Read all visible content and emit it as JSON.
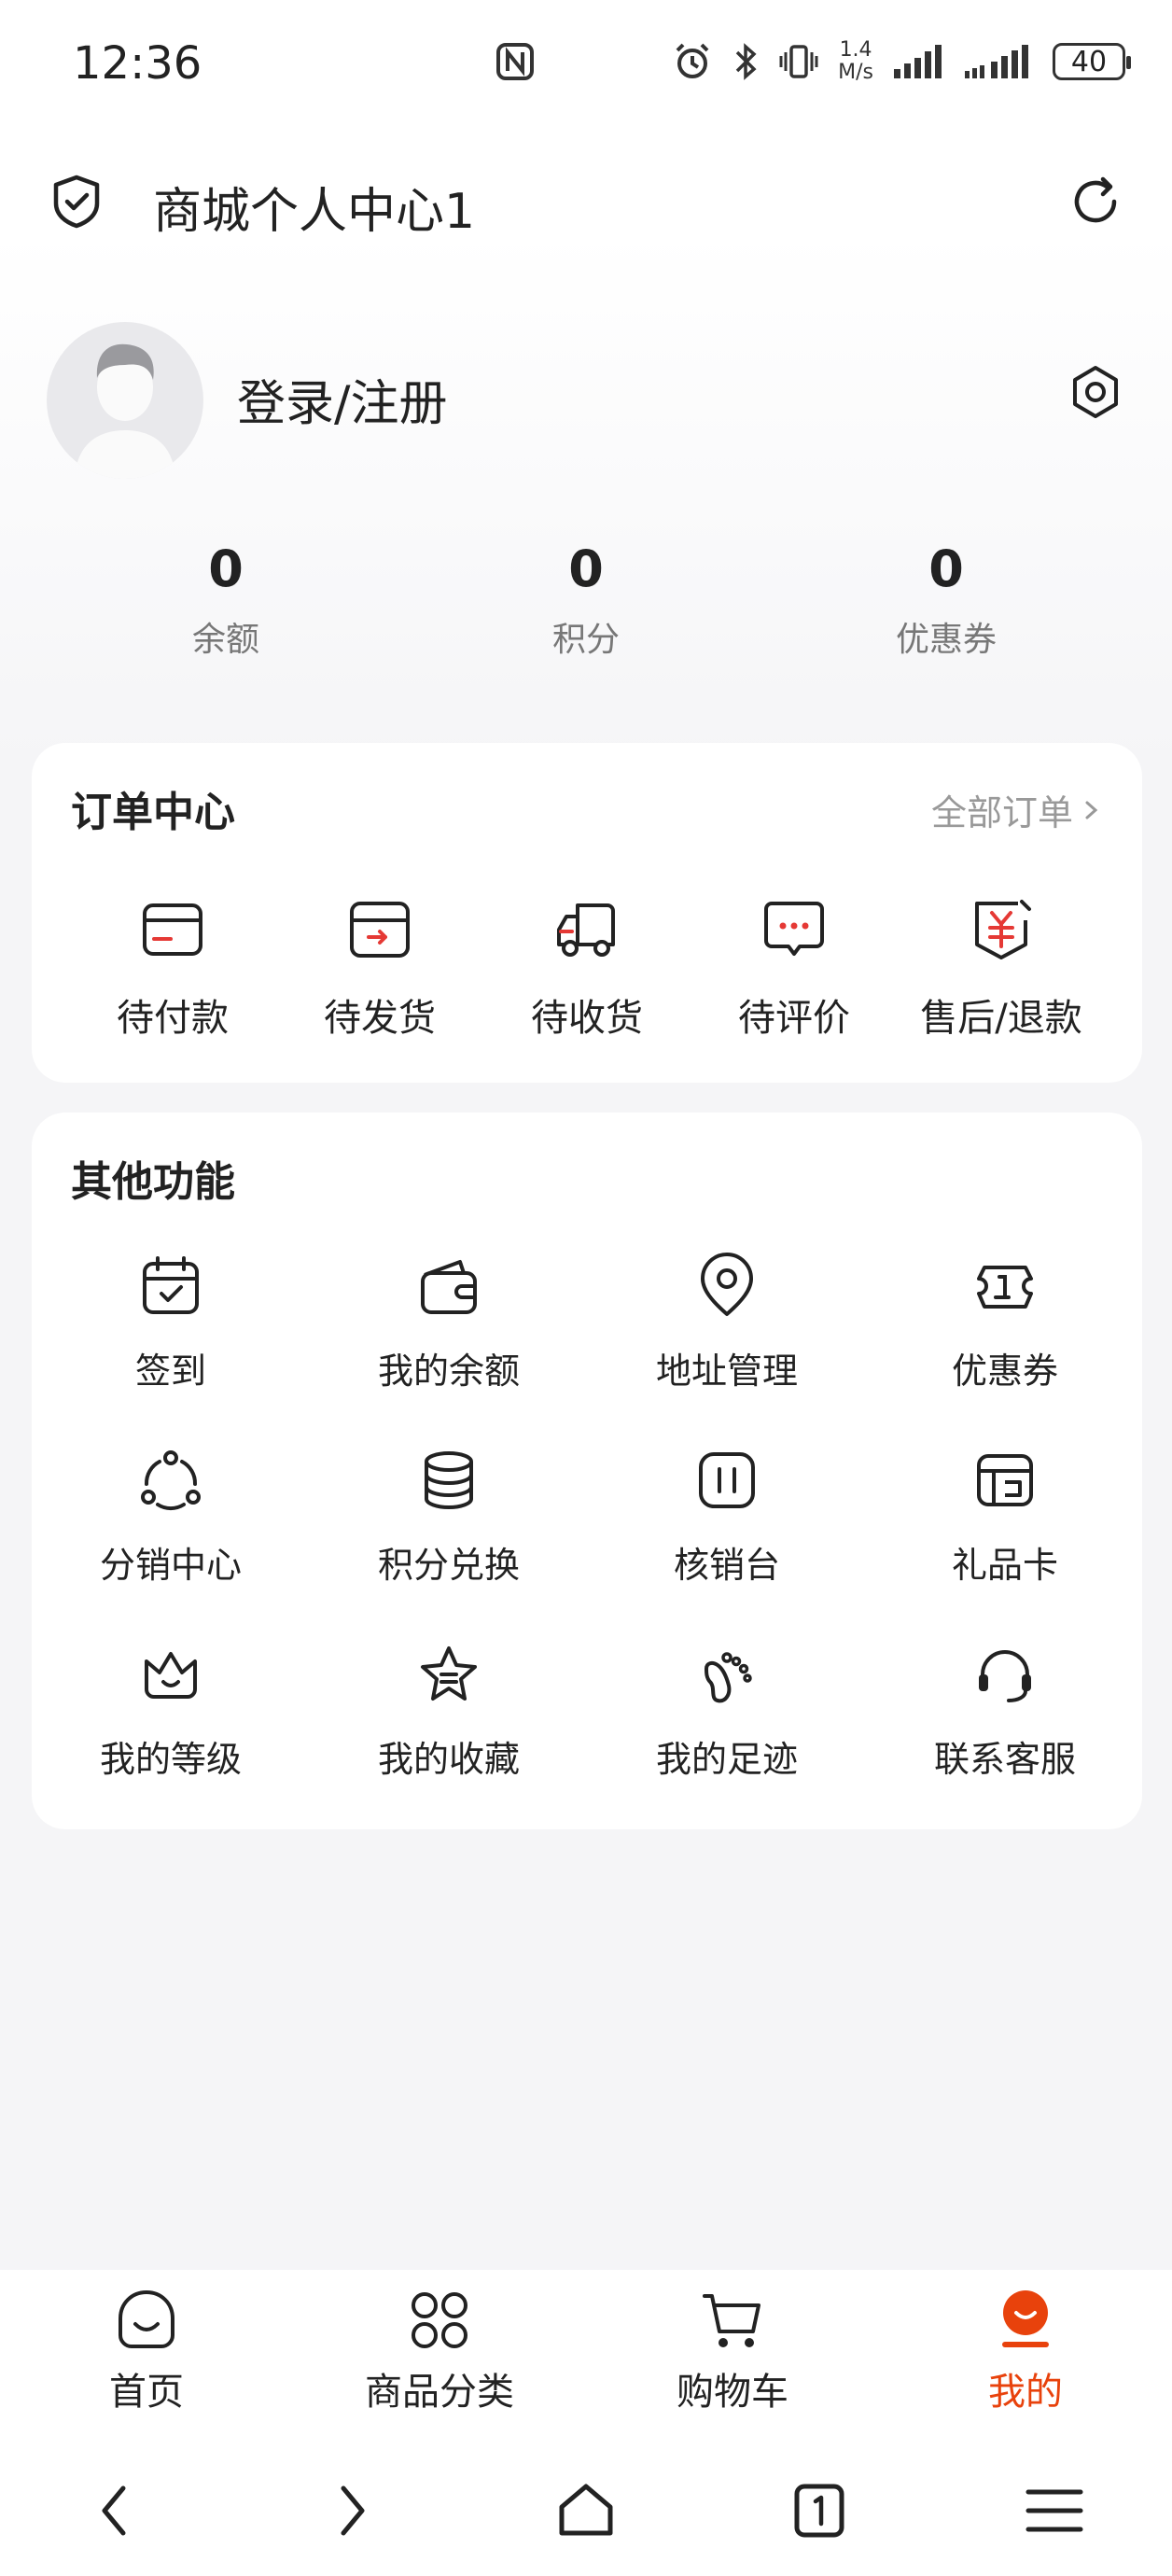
{
  "status_bar": {
    "time": "12:36",
    "net_speed_value": "1.4",
    "net_speed_unit": "M/s",
    "battery": "40"
  },
  "header": {
    "title": "商城个人中心1"
  },
  "profile": {
    "login_label": "登录/注册"
  },
  "stats": [
    {
      "value": "0",
      "label": "余额"
    },
    {
      "value": "0",
      "label": "积分"
    },
    {
      "value": "0",
      "label": "优惠券"
    }
  ],
  "orders": {
    "title": "订单中心",
    "all_label": "全部订单",
    "items": [
      {
        "label": "待付款",
        "icon": "card-icon"
      },
      {
        "label": "待发货",
        "icon": "box-icon"
      },
      {
        "label": "待收货",
        "icon": "truck-icon"
      },
      {
        "label": "待评价",
        "icon": "comment-icon"
      },
      {
        "label": "售后/退款",
        "icon": "refund-icon"
      }
    ]
  },
  "functions": {
    "title": "其他功能",
    "items": [
      {
        "label": "签到",
        "icon": "calendar-check-icon"
      },
      {
        "label": "我的余额",
        "icon": "wallet-icon"
      },
      {
        "label": "地址管理",
        "icon": "location-icon"
      },
      {
        "label": "优惠券",
        "icon": "ticket-icon"
      },
      {
        "label": "分销中心",
        "icon": "share-nodes-icon"
      },
      {
        "label": "积分兑换",
        "icon": "database-icon"
      },
      {
        "label": "核销台",
        "icon": "verify-icon"
      },
      {
        "label": "礼品卡",
        "icon": "gift-card-icon"
      },
      {
        "label": "我的等级",
        "icon": "crown-icon"
      },
      {
        "label": "我的收藏",
        "icon": "star-icon"
      },
      {
        "label": "我的足迹",
        "icon": "footprint-icon"
      },
      {
        "label": "联系客服",
        "icon": "headset-icon"
      }
    ]
  },
  "tabbar": {
    "items": [
      {
        "label": "首页",
        "icon": "home-smile-icon",
        "active": false
      },
      {
        "label": "商品分类",
        "icon": "category-icon",
        "active": false
      },
      {
        "label": "购物车",
        "icon": "cart-icon",
        "active": false
      },
      {
        "label": "我的",
        "icon": "profile-icon",
        "active": true
      }
    ],
    "active_color": "#e8420c"
  }
}
